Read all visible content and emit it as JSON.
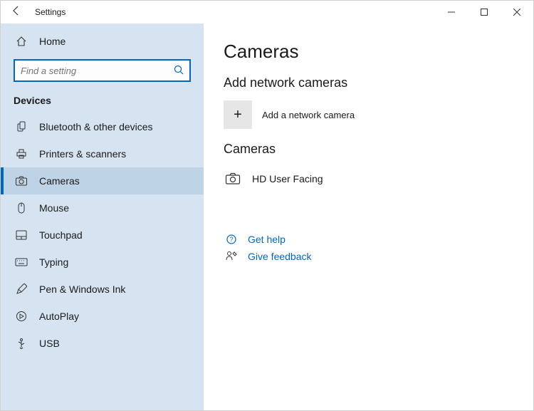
{
  "window": {
    "title": "Settings"
  },
  "sidebar": {
    "home_label": "Home",
    "search_placeholder": "Find a setting",
    "group_label": "Devices",
    "items": [
      {
        "label": "Bluetooth & other devices"
      },
      {
        "label": "Printers & scanners"
      },
      {
        "label": "Cameras"
      },
      {
        "label": "Mouse"
      },
      {
        "label": "Touchpad"
      },
      {
        "label": "Typing"
      },
      {
        "label": "Pen & Windows Ink"
      },
      {
        "label": "AutoPlay"
      },
      {
        "label": "USB"
      }
    ],
    "active_index": 2
  },
  "main": {
    "title": "Cameras",
    "add_section_title": "Add network cameras",
    "add_button_label": "Add a network camera",
    "cameras_section_title": "Cameras",
    "cameras": [
      {
        "name": "HD User Facing"
      }
    ],
    "help_label": "Get help",
    "feedback_label": "Give feedback"
  }
}
